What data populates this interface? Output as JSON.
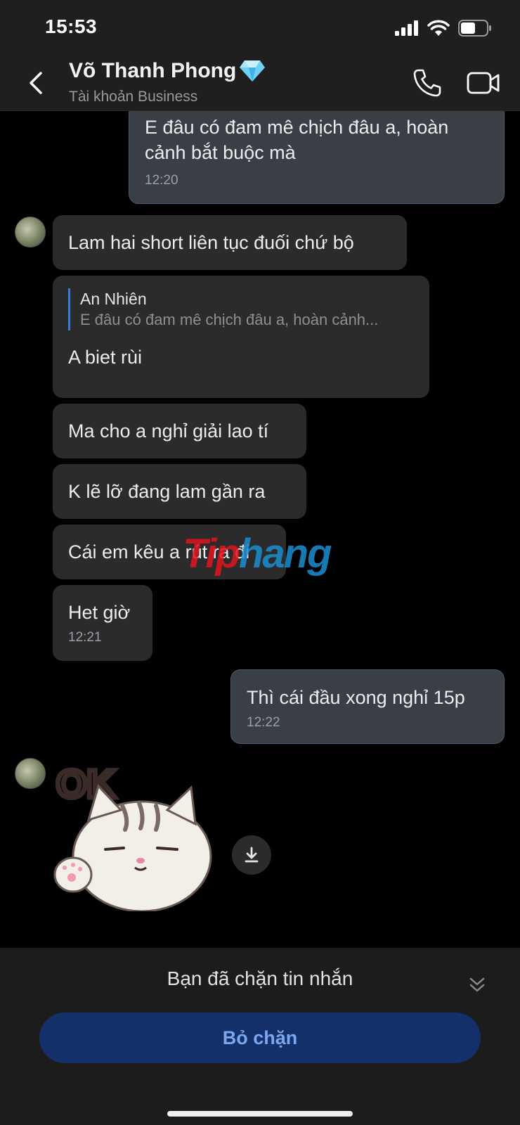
{
  "status_bar": {
    "time": "15:53",
    "icons": [
      "signal-icon",
      "wifi-icon",
      "battery-icon"
    ]
  },
  "header": {
    "contact_name": "Võ Thanh Phong",
    "badge_icon": "diamond-icon",
    "subtitle": "Tài khoản Business"
  },
  "messages": [
    {
      "from": "me",
      "text": "E đâu có đam mê chịch đâu a, hoàn cảnh bắt buộc mà",
      "time": "12:20"
    },
    {
      "from": "them",
      "text": "Lam hai short liên tục đuối chứ bộ"
    },
    {
      "from": "them",
      "reply_author": "An Nhiên",
      "reply_text": "E đâu có đam mê chịch đâu a, hoàn cảnh...",
      "text": "A biet rùi"
    },
    {
      "from": "them",
      "text": "Ma cho a nghỉ giải lao tí"
    },
    {
      "from": "them",
      "text": "K lẽ lỡ đang lam gần ra"
    },
    {
      "from": "them",
      "text": "Cái em kêu a rút ra đi"
    },
    {
      "from": "them",
      "text": "Het giờ",
      "time": "12:21"
    },
    {
      "from": "me",
      "text": "Thì cái đầu xong nghỉ 15p",
      "time": "12:22"
    },
    {
      "from": "them",
      "sticker_text": "OK",
      "sticker_icon": "cat-ok-sticker"
    }
  ],
  "watermark": {
    "part1": "Tip",
    "part2": "hang"
  },
  "bottom": {
    "blocked_text": "Bạn đã chặn tin nhắn",
    "unblock_label": "Bỏ chặn"
  },
  "colors": {
    "background": "#000000",
    "bubble_them": "#2b2b2b",
    "bubble_me": "#3a3f47",
    "accent": "#3a7bd5",
    "unblock_bg": "#13306b",
    "unblock_text": "#7aa7f0"
  }
}
